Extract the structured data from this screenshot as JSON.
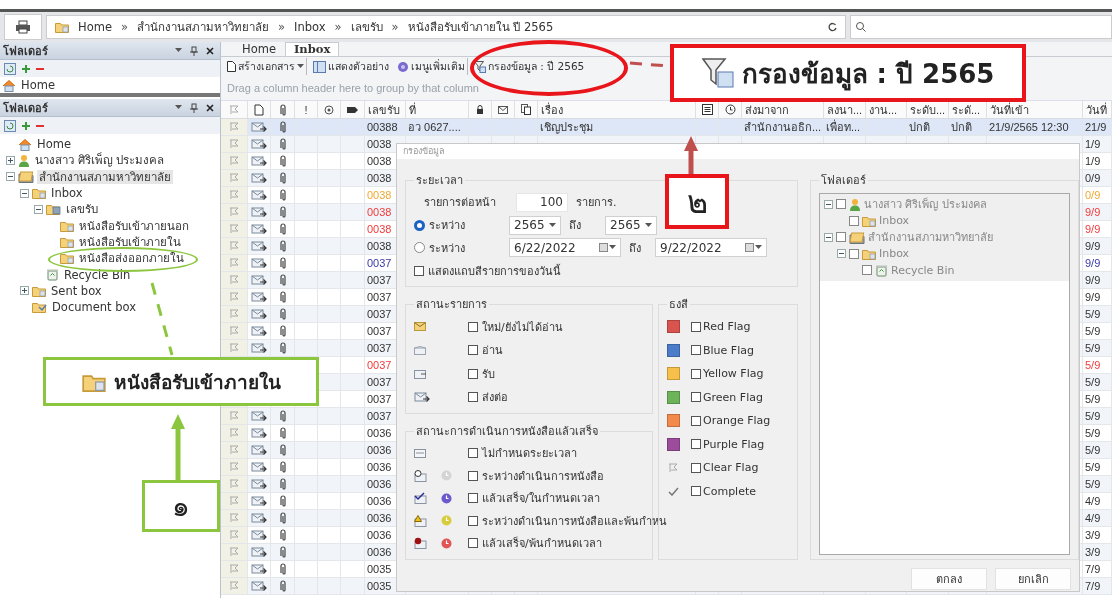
{
  "topbar": {
    "breadcrumb": [
      "Home",
      "สำนักงานสภามหาวิทยาลัย",
      "Inbox",
      "เลขรับ",
      "หนังสือรับเข้าภายใน ปี 2565"
    ],
    "separator": "»"
  },
  "folder_panel_back": {
    "title": "โฟลเดอร์",
    "items": [
      {
        "label": "Home",
        "kind": "home"
      }
    ]
  },
  "folder_panel": {
    "title": "โฟลเดอร์",
    "tree": [
      {
        "label": "Home",
        "kind": "home",
        "selected": false
      },
      {
        "label": "นางสาว ศิริเพ็ญ ประมงคล",
        "kind": "user",
        "selected": false,
        "expanded": false
      },
      {
        "label": "สำนักงานสภามหาวิทยาลัย",
        "kind": "office",
        "selected": true,
        "expanded": true,
        "children": [
          {
            "label": "Inbox",
            "kind": "folder",
            "selected": false,
            "expanded": true,
            "children": [
              {
                "label": "เลขรับ",
                "kind": "stack",
                "selected": false,
                "expanded": true,
                "children": [
                  {
                    "label": "หนังสือรับเข้าภายนอก",
                    "kind": "folder",
                    "selected": false
                  },
                  {
                    "label": "หนังสือรับเข้าภายใน",
                    "kind": "folder",
                    "selected": false
                  },
                  {
                    "label": "หนังสือส่งออกภายใน",
                    "kind": "folder",
                    "selected": false
                  }
                ]
              },
              {
                "label": "Recycle Bin",
                "kind": "bin",
                "selected": false
              }
            ]
          },
          {
            "label": "Sent box",
            "kind": "folder",
            "selected": false,
            "expanded": false
          },
          {
            "label": "Document box",
            "kind": "box",
            "selected": false
          }
        ]
      }
    ]
  },
  "tabs": [
    {
      "label": "Home",
      "selected": false
    },
    {
      "label": "Inbox",
      "selected": true
    }
  ],
  "toolbar": [
    {
      "label": "สร้างเอกสาร",
      "kind": "menu"
    },
    {
      "label": "แสดงตัวอย่าง",
      "kind": "preview"
    },
    {
      "label": "เมนูเพิ่มเติม",
      "kind": "more"
    },
    {
      "label": "กรองข้อมูล : ปี 2565",
      "kind": "filter"
    }
  ],
  "group_hint": "Drag a column header here to group by that column",
  "table": {
    "columns": [
      {
        "kind": "icon"
      },
      {
        "kind": "icon"
      },
      {
        "kind": "icon"
      },
      {
        "kind": "text",
        "label": "!"
      },
      {
        "kind": "icon"
      },
      {
        "kind": "icon"
      },
      {
        "kind": "text",
        "label": "เลขรับ"
      },
      {
        "kind": "text",
        "label": "ที่"
      },
      {
        "kind": "icon"
      },
      {
        "kind": "icon"
      },
      {
        "kind": "icon"
      },
      {
        "kind": "text",
        "label": "เรื่อง"
      },
      {
        "kind": "icon"
      },
      {
        "kind": "icon"
      },
      {
        "kind": "text",
        "label": "ส่งมาจาก"
      },
      {
        "kind": "text",
        "label": "ลงนา..."
      },
      {
        "kind": "text",
        "label": "งาน..."
      },
      {
        "kind": "text",
        "label": "ระดับ..."
      },
      {
        "kind": "text",
        "label": "ระดั..."
      },
      {
        "kind": "text",
        "label": "วันที่เข้า"
      },
      {
        "kind": "text",
        "label": "วันที่"
      }
    ],
    "rows": [
      {
        "number": "00388",
        "ref": "อว 0627....",
        "subject": "เชิญประชุม",
        "from": "สำนักงานอธิก...",
        "sign": "เพื่อท...",
        "priority": "ปกติ",
        "secrecy": "ปกติ",
        "received": "21/9/2565 12:30",
        "date": "21/9",
        "color": "#333333",
        "selected": true
      },
      {
        "number": "0038",
        "date": "1/9",
        "color": "#333333",
        "selected": false
      },
      {
        "number": "0038",
        "date": "1/9",
        "color": "#333333",
        "selected": false
      },
      {
        "number": "0038",
        "date": "0/9",
        "color": "#333333",
        "selected": false
      },
      {
        "number": "0038",
        "date": "0/9",
        "color": "#f0a830",
        "selected": false
      },
      {
        "number": "0038",
        "date": "9/9",
        "color": "#f03c3c",
        "selected": false
      },
      {
        "number": "0038",
        "date": "9/9",
        "color": "#f03c3c",
        "selected": false
      },
      {
        "number": "0038",
        "date": "9/9",
        "color": "#333333",
        "selected": false
      },
      {
        "number": "0037",
        "date": "9/9",
        "color": "#3a3aa8",
        "selected": false
      },
      {
        "number": "0037",
        "date": "9/9",
        "color": "#333333",
        "selected": false
      },
      {
        "number": "0037",
        "date": "9/9",
        "color": "#333333",
        "selected": false
      },
      {
        "number": "0037",
        "date": "5/9",
        "color": "#333333",
        "selected": false
      },
      {
        "number": "0037",
        "date": "5/9",
        "color": "#333333",
        "selected": false
      },
      {
        "number": "0037",
        "date": "5/9",
        "color": "#333333",
        "selected": false
      },
      {
        "number": "0037",
        "date": "5/9",
        "color": "#f03c3c",
        "selected": false
      },
      {
        "number": "0037",
        "date": "5/9",
        "color": "#333333",
        "selected": false
      },
      {
        "number": "0037",
        "date": "5/9",
        "color": "#333333",
        "selected": false
      },
      {
        "number": "0037",
        "date": "5/9",
        "color": "#333333",
        "selected": false
      },
      {
        "number": "0036",
        "date": "5/9",
        "color": "#333333",
        "selected": false
      },
      {
        "number": "0036",
        "date": "5/9",
        "color": "#333333",
        "selected": false
      },
      {
        "number": "0036",
        "date": "5/9",
        "color": "#333333",
        "selected": false
      },
      {
        "number": "0036",
        "date": "5/9",
        "color": "#333333",
        "selected": false
      },
      {
        "number": "0036",
        "date": "4/9",
        "color": "#333333",
        "selected": false
      },
      {
        "number": "0036",
        "date": "4/9",
        "color": "#333333",
        "selected": false
      },
      {
        "number": "0036",
        "date": "3/9",
        "color": "#333333",
        "selected": false
      },
      {
        "number": "0036",
        "date": "3/9",
        "color": "#333333",
        "selected": false
      },
      {
        "number": "0035",
        "date": "7/9",
        "color": "#333333",
        "selected": false
      },
      {
        "number": "0035",
        "date": "7/9",
        "color": "#333333",
        "selected": false
      }
    ]
  },
  "dialog": {
    "title": "กรองข้อมูล",
    "period": {
      "title": "ระยะเวลา",
      "per_page": {
        "label": "รายการต่อหน้า",
        "value": "100",
        "unit": "รายการ."
      },
      "ranges": [
        {
          "kind": "year",
          "label": "ระหว่าง",
          "selected": true,
          "from": "2565",
          "to_label": "ถึง",
          "to": "2565"
        },
        {
          "kind": "date",
          "label": "ระหว่าง",
          "selected": false,
          "from": "6/22/2022",
          "to_label": "ถึง",
          "to": "9/22/2022"
        }
      ],
      "today_band": {
        "label": "แสดงแถบสีรายการของวันนี้",
        "checked": false
      }
    },
    "status": {
      "title": "สถานะรายการ",
      "items": [
        {
          "label": "ใหม่/ยังไม่ได้อ่าน",
          "checked": false
        },
        {
          "label": "อ่าน",
          "checked": false
        },
        {
          "label": "รับ",
          "checked": false
        },
        {
          "label": "ส่งต่อ",
          "checked": false
        }
      ]
    },
    "progress": {
      "title": "สถานะการดำเนินการหนังสือแล้วเสร็จ",
      "items": [
        {
          "label": "ไม่กำหนดระยะเวลา",
          "checked": false
        },
        {
          "label": "ระหว่างดำเนินการหนังสือ",
          "checked": false,
          "color": "#d4d4d4"
        },
        {
          "label": "แล้วเสร็จ/ในกำหนดเวลา",
          "checked": false,
          "color": "#6a5acd"
        },
        {
          "label": "ระหว่างดำเนินการหนังสือและพ้นกำหน",
          "checked": false,
          "color": "#d8cc3c"
        },
        {
          "label": "แล้วเสร็จ/พ้นกำหนดเวลา",
          "checked": false,
          "color": "#e05555"
        }
      ]
    },
    "flags": {
      "title": "ธงสี",
      "items": [
        {
          "kind": "flag",
          "label": "Red Flag",
          "color": "#d9534f",
          "checked": false
        },
        {
          "kind": "flag",
          "label": "Blue Flag",
          "color": "#4a7cc9",
          "checked": false
        },
        {
          "kind": "flag",
          "label": "Yellow Flag",
          "color": "#f6c04a",
          "checked": false
        },
        {
          "kind": "flag",
          "label": "Green Flag",
          "color": "#6db35a",
          "checked": false
        },
        {
          "kind": "flag",
          "label": "Orange Flag",
          "color": "#f28a4c",
          "checked": false
        },
        {
          "kind": "flag",
          "label": "Purple Flag",
          "color": "#9b4d9b",
          "checked": false
        },
        {
          "kind": "clear",
          "label": "Clear Flag",
          "checked": false
        },
        {
          "kind": "complete",
          "label": "Complete",
          "checked": false
        }
      ]
    },
    "folders": {
      "title": "โฟลเดอร์",
      "tree": [
        {
          "label": "นางสาว ศิริเพ็ญ ประมงคล",
          "kind": "user",
          "checked": false,
          "expanded": true,
          "children": [
            {
              "label": "Inbox",
              "kind": "folder",
              "checked": false
            }
          ]
        },
        {
          "label": "สำนักงานสภามหาวิทยาลัย",
          "kind": "office",
          "checked": false,
          "expanded": true,
          "children": [
            {
              "label": "Inbox",
              "kind": "folder",
              "checked": false,
              "expanded": true,
              "children": [
                {
                  "label": "Recycle Bin",
                  "kind": "bin",
                  "checked": false
                }
              ]
            }
          ]
        }
      ]
    },
    "buttons": [
      "ตกลง",
      "ยกเลิก"
    ]
  },
  "annotations": {
    "filter_zoom": "กรองข้อมูล : ปี 2565",
    "step_two": "๒",
    "folder_zoom": "หนังสือรับเข้าภายใน",
    "step_one": "๑"
  }
}
